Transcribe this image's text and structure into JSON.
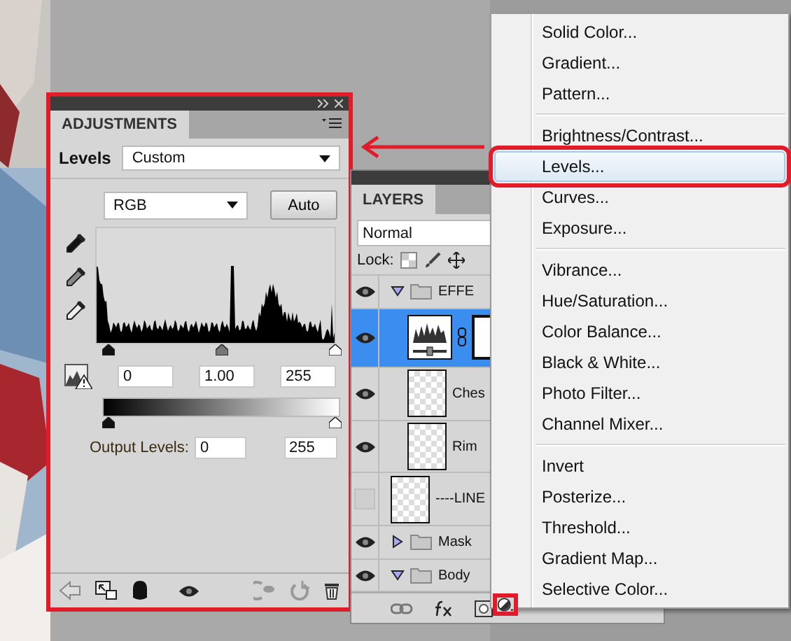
{
  "adjustments": {
    "tab": "ADJUSTMENTS",
    "preset_label": "Levels",
    "preset": "Custom",
    "channel": "RGB",
    "auto_button": "Auto",
    "input_thumbs": [
      {
        "level": 0
      },
      {
        "level": 0.5
      },
      {
        "level": 1
      }
    ],
    "input_values": [
      "0",
      "1.00",
      "255"
    ],
    "output_thumbs": [
      {
        "level": 0
      },
      {
        "level": 1
      }
    ],
    "output_label": "Output Levels:",
    "output_values": [
      "0",
      "255"
    ]
  },
  "layers": {
    "tab": "LAYERS",
    "blend_mode": "Normal",
    "lock_label": "Lock:",
    "items": [
      {
        "name": "EFFE",
        "kind": "group",
        "visible": true,
        "expanded": true,
        "selected": false,
        "children": [
          {
            "kind": "adjustment",
            "visible": true,
            "selected": true
          },
          {
            "name": "Ches",
            "kind": "layer",
            "visible": true,
            "selected": false
          },
          {
            "name": "Rim",
            "kind": "layer",
            "visible": true,
            "selected": false
          }
        ]
      },
      {
        "name": "----LINE",
        "kind": "layer",
        "visible": false,
        "selected": false
      },
      {
        "name": "Mask",
        "kind": "group",
        "visible": true,
        "expanded": false,
        "selected": false
      },
      {
        "name": "Body",
        "kind": "group",
        "visible": true,
        "expanded": true,
        "selected": false
      }
    ]
  },
  "menu": {
    "groups": [
      [
        {
          "label": "Solid Color...",
          "selected": false
        },
        {
          "label": "Gradient...",
          "selected": false
        },
        {
          "label": "Pattern...",
          "selected": false
        }
      ],
      [
        {
          "label": "Brightness/Contrast...",
          "selected": false
        },
        {
          "label": "Levels...",
          "selected": true
        },
        {
          "label": "Curves...",
          "selected": false
        },
        {
          "label": "Exposure...",
          "selected": false
        }
      ],
      [
        {
          "label": "Vibrance...",
          "selected": false
        },
        {
          "label": "Hue/Saturation...",
          "selected": false
        },
        {
          "label": "Color Balance...",
          "selected": false
        },
        {
          "label": "Black & White...",
          "selected": false
        },
        {
          "label": "Photo Filter...",
          "selected": false
        },
        {
          "label": "Channel Mixer...",
          "selected": false
        }
      ],
      [
        {
          "label": "Invert",
          "selected": false
        },
        {
          "label": "Posterize...",
          "selected": false
        },
        {
          "label": "Threshold...",
          "selected": false
        },
        {
          "label": "Gradient Map...",
          "selected": false
        },
        {
          "label": "Selective Color...",
          "selected": false
        }
      ]
    ]
  }
}
